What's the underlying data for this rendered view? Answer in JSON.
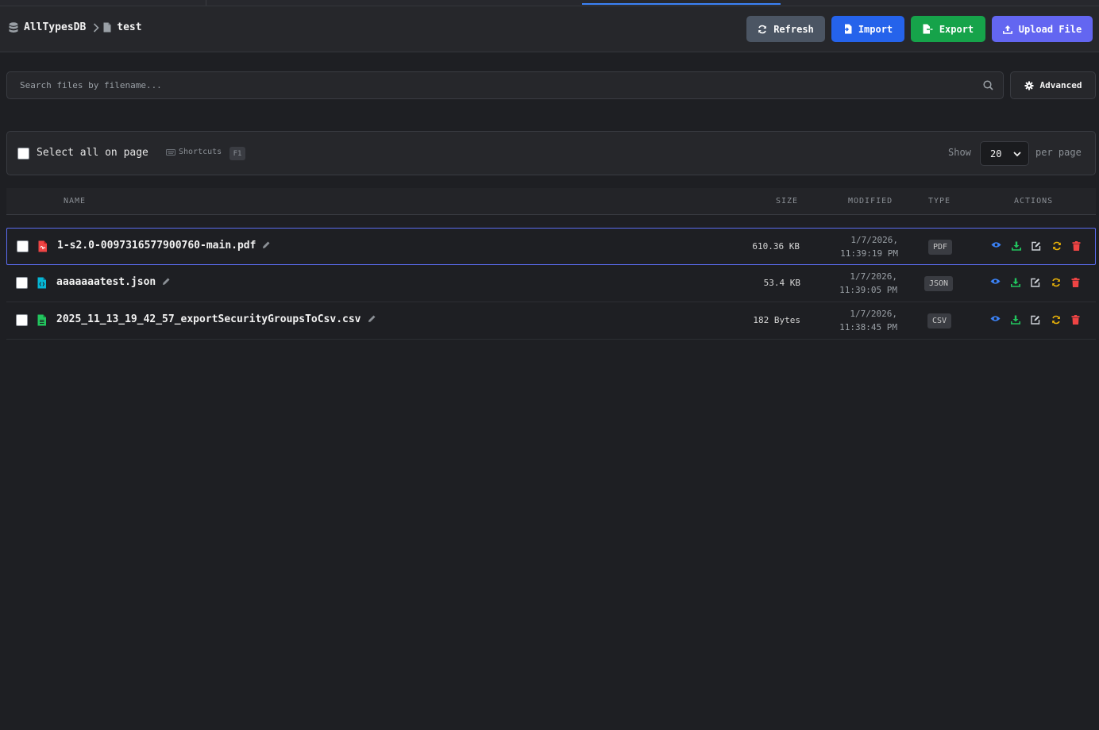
{
  "breadcrumb": {
    "database": "AllTypesDB",
    "collection": "test"
  },
  "header": {
    "refresh_label": "Refresh",
    "import_label": "Import",
    "export_label": "Export",
    "upload_label": "Upload File"
  },
  "search": {
    "placeholder": "Search files by filename...",
    "value": "",
    "advanced_label": "Advanced"
  },
  "toolbar": {
    "select_all_label": "Select all on page",
    "shortcuts_label": "Shortcuts",
    "shortcuts_key": "F1",
    "show_label": "Show",
    "per_page_value": "20",
    "per_page_label": "per page"
  },
  "table": {
    "columns": [
      "NAME",
      "SIZE",
      "MODIFIED",
      "TYPE",
      "ACTIONS"
    ],
    "rows": [
      {
        "name": "1-s2.0-0097316577900760-main.pdf",
        "size": "610.36 KB",
        "modified_date": "1/7/2026,",
        "modified_time": "11:39:19 PM",
        "type": "PDF",
        "icon": "pdf-file-icon",
        "selected": true
      },
      {
        "name": "aaaaaaatest.json",
        "size": "53.4 KB",
        "modified_date": "1/7/2026,",
        "modified_time": "11:39:05 PM",
        "type": "JSON",
        "icon": "json-file-icon",
        "selected": false
      },
      {
        "name": "2025_11_13_19_42_57_exportSecurityGroupsToCsv.csv",
        "size": "182 Bytes",
        "modified_date": "1/7/2026,",
        "modified_time": "11:38:45 PM",
        "type": "CSV",
        "icon": "csv-file-icon",
        "selected": false
      }
    ]
  },
  "colors": {
    "background": "#1e1f23",
    "refresh": "#4b5563",
    "import": "#2563eb",
    "export": "#16a34a",
    "upload": "#6366f1",
    "view_action": "#3b82f6",
    "download_action": "#22c55e",
    "edit_action": "#d1d5db",
    "replace_action": "#eab308",
    "delete_action": "#ef4444",
    "pdf_icon": "#ef4444",
    "json_icon": "#06b6d4",
    "csv_icon": "#22c55e"
  }
}
